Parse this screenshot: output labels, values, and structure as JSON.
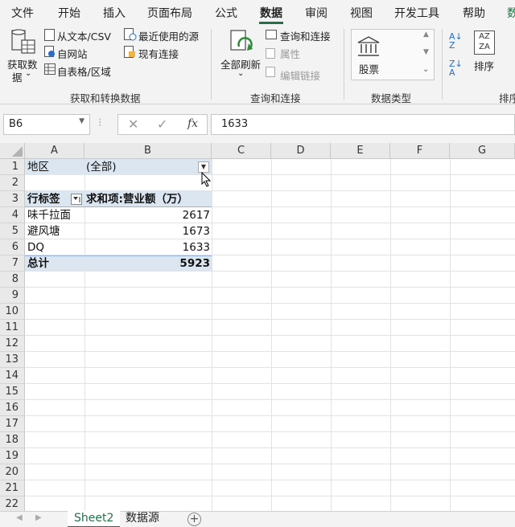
{
  "ribbon_tabs": [
    "文件",
    "开始",
    "插入",
    "页面布局",
    "公式",
    "数据",
    "审阅",
    "视图",
    "开发工具",
    "帮助",
    "数"
  ],
  "active_tab": "数据",
  "groups": {
    "get_transform": {
      "get_data_label": "获取数",
      "get_data_label2": "据",
      "from_text": "从文本/CSV",
      "from_web": "自网站",
      "from_table": "自表格/区域",
      "recent_sources": "最近使用的源",
      "existing_conn": "现有连接",
      "group_label": "获取和转换数据"
    },
    "queries": {
      "refresh_all": "全部刷新",
      "queries_conn": "查询和连接",
      "properties": "属性",
      "edit_links": "编辑链接",
      "group_label": "查询和连接"
    },
    "data_types": {
      "stocks": "股票",
      "group_label": "数据类型"
    },
    "sort": {
      "sort_label": "排序",
      "group_label": "排序"
    }
  },
  "formula_bar": {
    "name_box": "B6",
    "fx": "fx",
    "value": "1633"
  },
  "columns": [
    "A",
    "B",
    "C",
    "D",
    "E",
    "F",
    "G"
  ],
  "rows": [
    "1",
    "2",
    "3",
    "4",
    "5",
    "6",
    "7",
    "8",
    "9",
    "10",
    "11",
    "12",
    "13",
    "14",
    "15",
    "16",
    "17",
    "18",
    "19",
    "20",
    "21",
    "22"
  ],
  "pivot": {
    "filter_label": "地区",
    "filter_value": "(全部)",
    "row_label_header": "行标签",
    "value_header": "求和项:营业额（万）",
    "items": [
      {
        "name": "味千拉面",
        "value": "2617"
      },
      {
        "name": "避风塘",
        "value": "1673"
      },
      {
        "name": "DQ",
        "value": "1633"
      }
    ],
    "total_label": "总计",
    "total_value": "5923"
  },
  "sheet_tabs": [
    "Sheet2",
    "数据源"
  ],
  "active_sheet": "Sheet2",
  "colors": {
    "accent": "#217346",
    "pivot_band": "#dce6f1",
    "pivot_header": "#dce6f1"
  }
}
